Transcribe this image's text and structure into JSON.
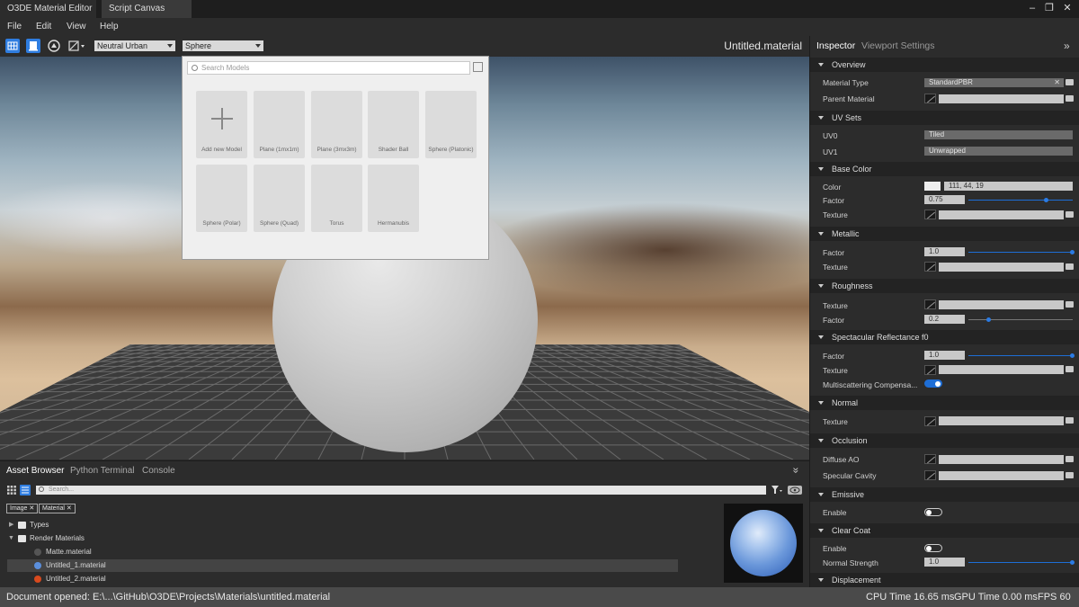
{
  "tabs": [
    {
      "label": "O3DE Material Editor",
      "active": true
    },
    {
      "label": "Script Canvas",
      "active": false
    }
  ],
  "window_controls": {
    "minimize": "–",
    "restore": "❐",
    "close": "✕"
  },
  "menu": {
    "items": [
      "File",
      "Edit",
      "View",
      "Help"
    ]
  },
  "toolbar": {
    "lighting_preset": "Neutral Urban",
    "model_preset": "Sphere",
    "document_title": "Untitled.material"
  },
  "model_picker": {
    "search_placeholder": "Search Models",
    "models": [
      "Add new Model",
      "Plane (1mx1m)",
      "Plane (3mx3m)",
      "Shader Ball",
      "Sphere (Platonic)",
      "Sphere (Polar)",
      "Sphere (Quad)",
      "Torus",
      "Hermanubis"
    ]
  },
  "inspector": {
    "tabs": [
      "Inspector",
      "Viewport Settings"
    ],
    "sections": {
      "overview": "Overview",
      "uv_sets": "UV Sets",
      "base_color": "Base Color",
      "metallic": "Metallic",
      "roughness": "Roughness",
      "specular": "Spectacular Reflectance f0",
      "normal": "Normal",
      "occlusion": "Occlusion",
      "emissive": "Emissive",
      "clear_coat": "Clear Coat",
      "displacement": "Displacement"
    },
    "labels": {
      "material_type": "Material Type",
      "parent_material": "Parent Material",
      "uv0": "UV0",
      "uv1": "UV1",
      "color": "Color",
      "factor": "Factor",
      "texture": "Texture",
      "multiscattering": "Multiscattering Compensa...",
      "diffuse_ao": "Diffuse AO",
      "specular_cavity": "Specular Cavity",
      "enable": "Enable",
      "normal_strength": "Normal Strength"
    },
    "values": {
      "material_type": "StandardPBR",
      "uv0": "Tiled",
      "uv1": "Unwrapped",
      "base_color_rgb": "111, 44, 19",
      "base_color_factor": "0.75",
      "metallic_factor": "1.0",
      "roughness_factor": "0.2",
      "specular_factor": "1.0",
      "clear_coat_normal_strength": "1.0"
    },
    "slider_levels": {
      "base_color_factor": 0.75,
      "metallic_factor": 1.0,
      "roughness_factor": 0.2,
      "specular_factor": 1.0,
      "clear_coat_normal_strength": 1.0
    },
    "toggles": {
      "multiscattering": true,
      "emissive_enable": false,
      "clear_coat_enable": false
    }
  },
  "asset_browser": {
    "tabs": [
      "Asset Browser",
      "Python Terminal",
      "Console"
    ],
    "search_placeholder": "Search...",
    "filter_tags": [
      "Image",
      "Material"
    ],
    "tree": [
      {
        "label": "Types",
        "kind": "folder"
      },
      {
        "label": "Render Materials",
        "kind": "folder"
      },
      {
        "label": "Matte.material",
        "kind": "material"
      },
      {
        "label": "Untitled_1.material",
        "kind": "material",
        "selected": true
      },
      {
        "label": "Untitled_2.material",
        "kind": "material"
      }
    ]
  },
  "status": {
    "message": "Document opened: E:\\...\\GitHub\\O3DE\\Projects\\Materials\\untitled.material",
    "cpu": "CPU Time 16.65 ms",
    "gpu": "GPU Time 0.00 ms",
    "fps": "FPS 60"
  },
  "colors": {
    "accent": "#1e6ed6",
    "panel": "#2c2c2c",
    "header": "#232323",
    "statusbar": "#4a4a4a"
  }
}
